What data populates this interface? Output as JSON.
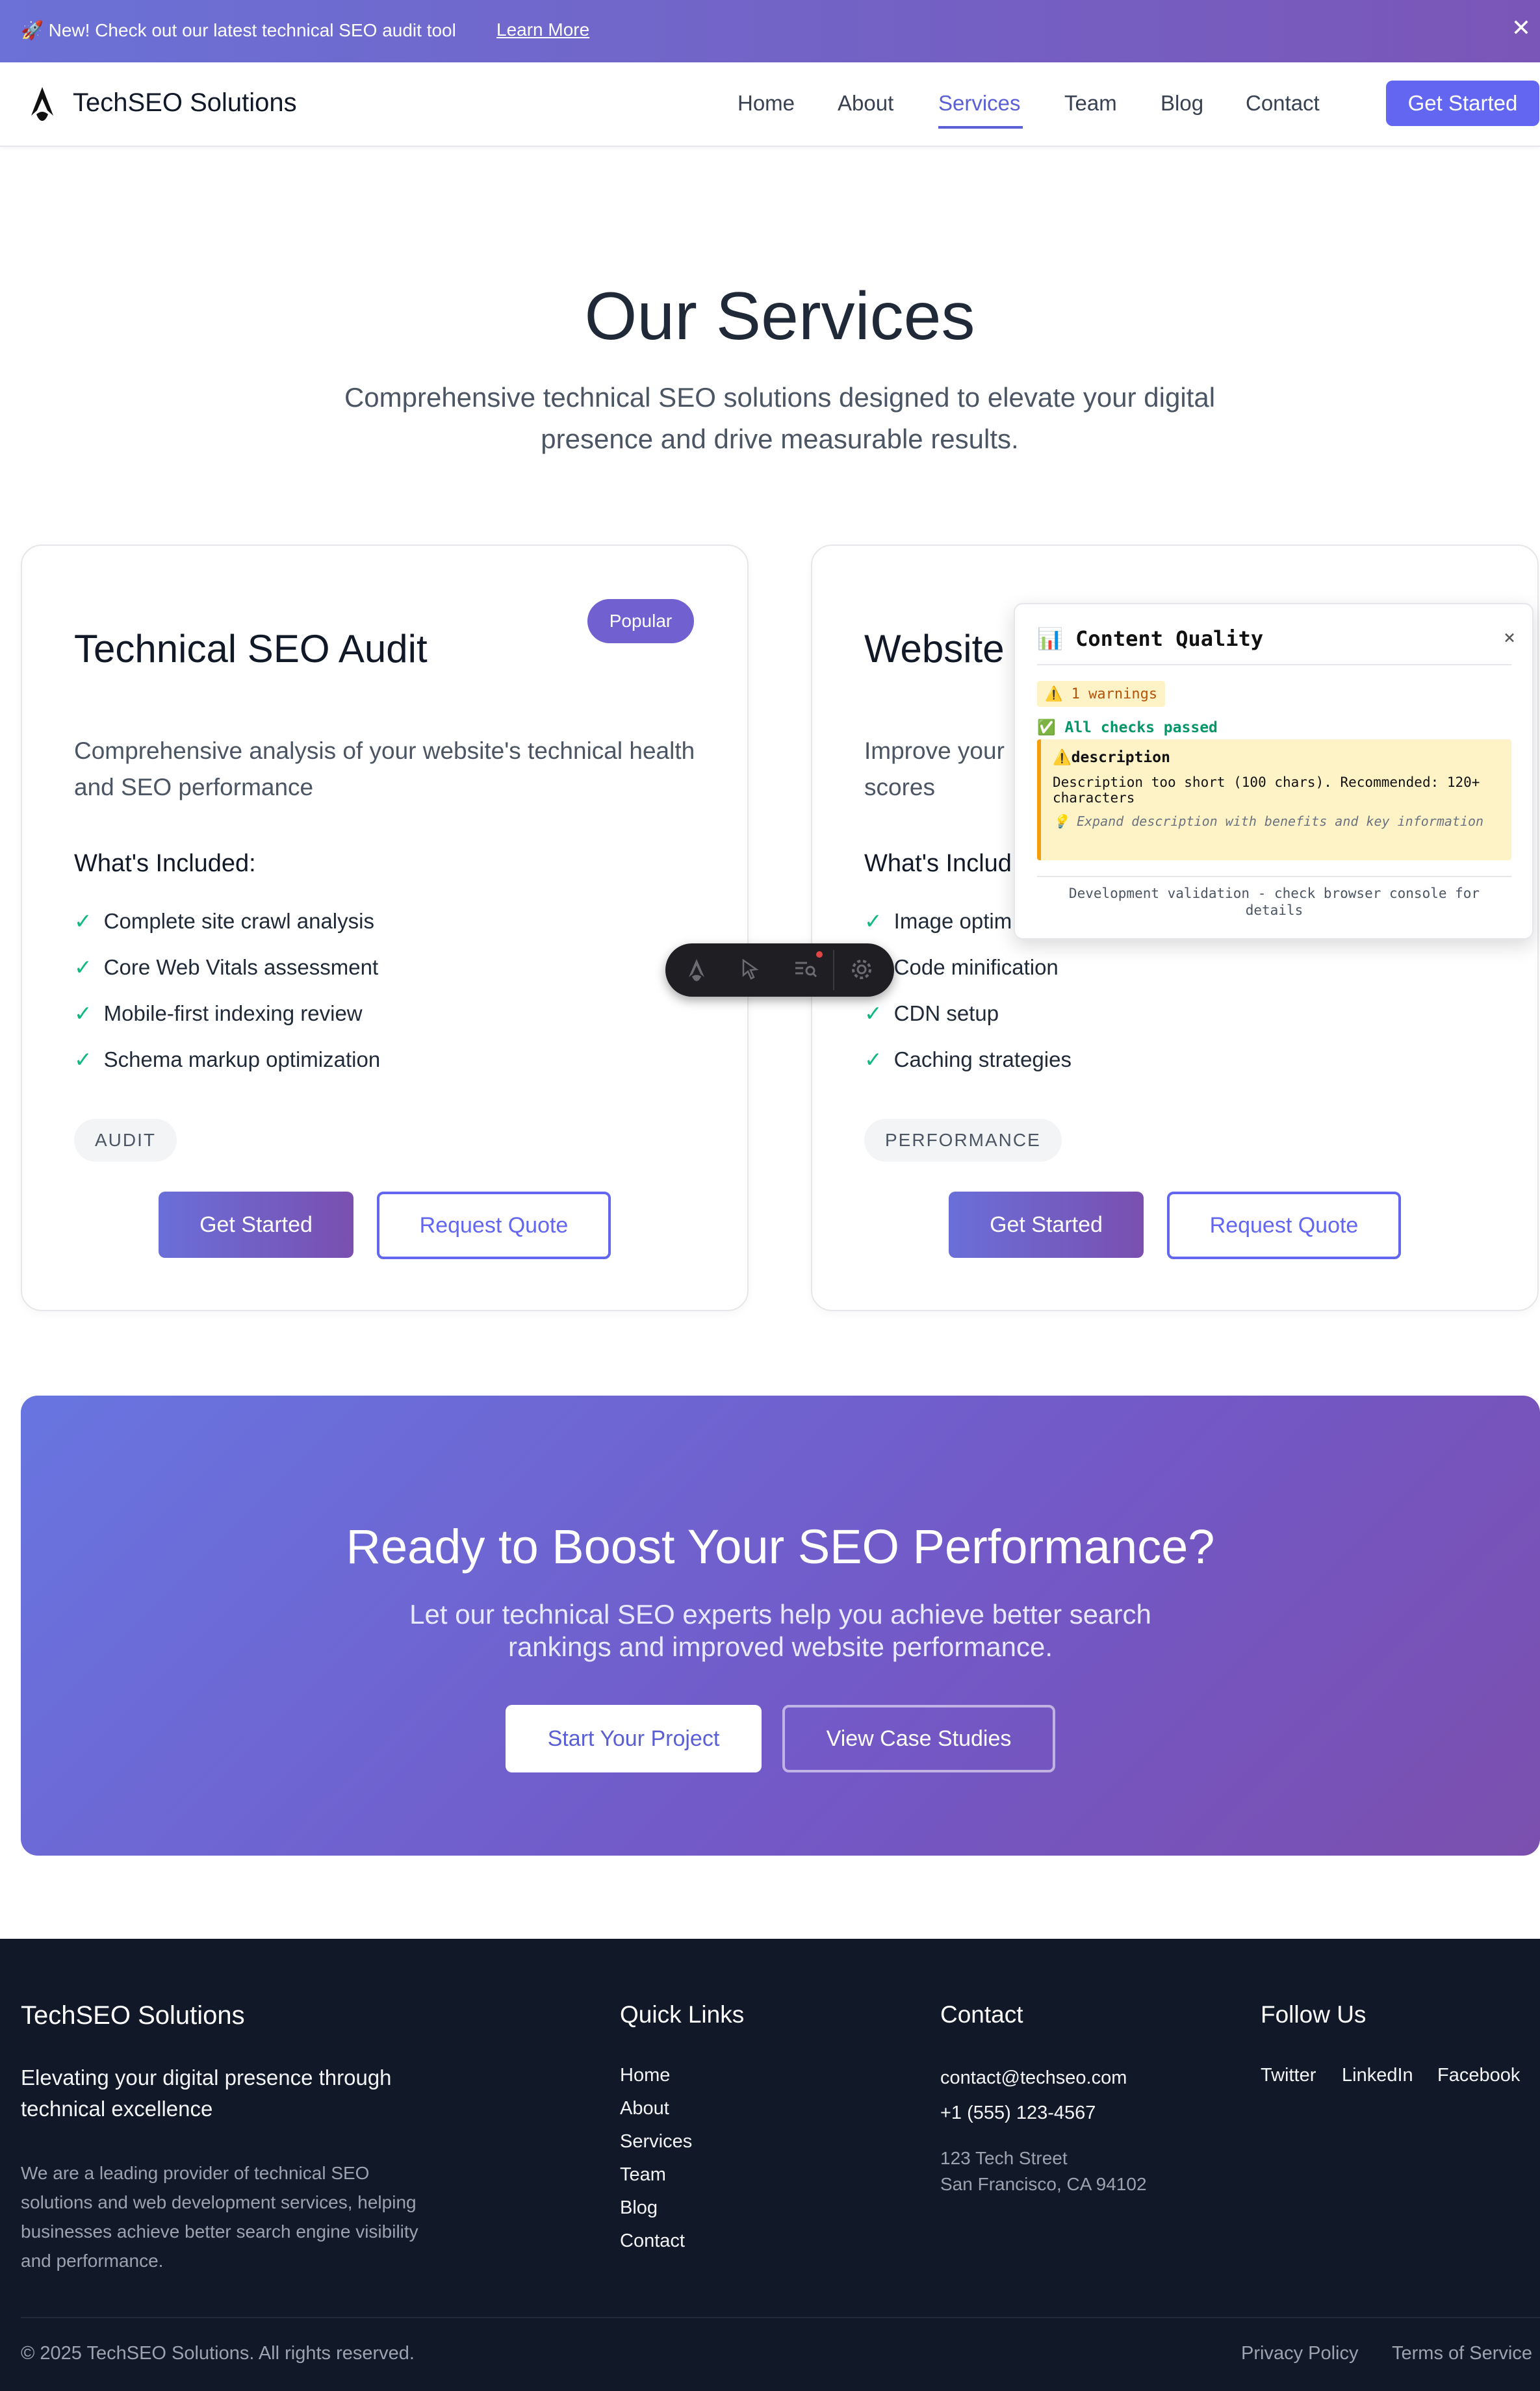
{
  "announcement": {
    "text": "🚀 New! Check out our latest technical SEO audit tool",
    "link": "Learn More",
    "close": "✕"
  },
  "nav": {
    "brand": "TechSEO Solutions",
    "links": [
      "Home",
      "About",
      "Services",
      "Team",
      "Blog",
      "Contact"
    ],
    "active": "Services",
    "cta": "Get Started",
    "accent_color": "#6366f1"
  },
  "hero": {
    "title": "Our Services",
    "subtitle": "Comprehensive technical SEO solutions designed to elevate your digital presence and drive measurable results."
  },
  "cards": [
    {
      "title": "Technical SEO Audit",
      "badge": "Popular",
      "description": "Comprehensive analysis of your website's technical health and SEO performance",
      "included_label": "What's Included:",
      "features": [
        "Complete site crawl analysis",
        "Core Web Vitals assessment",
        "Mobile-first indexing review",
        "Schema markup optimization"
      ],
      "tag": "AUDIT",
      "primary": "Get Started",
      "secondary": "Request Quote"
    },
    {
      "title": "Website",
      "description": "Improve your scores",
      "included_label": "What's Includ",
      "features": [
        "Image optim",
        "Code minification",
        "CDN setup",
        "Caching strategies"
      ],
      "tag": "PERFORMANCE",
      "primary": "Get Started",
      "secondary": "Request Quote"
    }
  ],
  "check_glyph": "✓",
  "quality_panel": {
    "title": "📊 Content Quality",
    "close": "×",
    "warnings": "⚠️ 1 warnings",
    "passed": "✅ All checks passed",
    "issue_title": "⚠️description",
    "issue_detail": "Description too short (100 chars). Recommended: 120+ characters",
    "issue_hint": "💡 Expand description with benefits and key information",
    "footer": "Development validation - check browser console for details"
  },
  "toolbar": {
    "icons": [
      "astro-logo-icon",
      "inspect-cursor-icon",
      "audit-search-icon",
      "settings-gear-icon"
    ]
  },
  "cta": {
    "title": "Ready to Boost Your SEO Performance?",
    "text": "Let our technical SEO experts help you achieve better search rankings and improved website performance.",
    "primary": "Start Your Project",
    "secondary": "View Case Studies"
  },
  "footer": {
    "brand": "TechSEO Solutions",
    "tagline": "Elevating your digital presence through technical excellence",
    "description": "We are a leading provider of technical SEO solutions and web development services, helping businesses achieve better search engine visibility and performance.",
    "quick_links_title": "Quick Links",
    "quick_links": [
      "Home",
      "About",
      "Services",
      "Team",
      "Blog",
      "Contact"
    ],
    "contact_title": "Contact",
    "email": "contact@techseo.com",
    "phone": "+1 (555) 123-4567",
    "address_1": "123 Tech Street",
    "address_2": "San Francisco, CA 94102",
    "follow_title": "Follow Us",
    "social": [
      "Twitter",
      "LinkedIn",
      "Facebook"
    ],
    "copyright": "© 2025 TechSEO Solutions. All rights reserved.",
    "privacy": "Privacy Policy",
    "terms": "Terms of Service"
  }
}
